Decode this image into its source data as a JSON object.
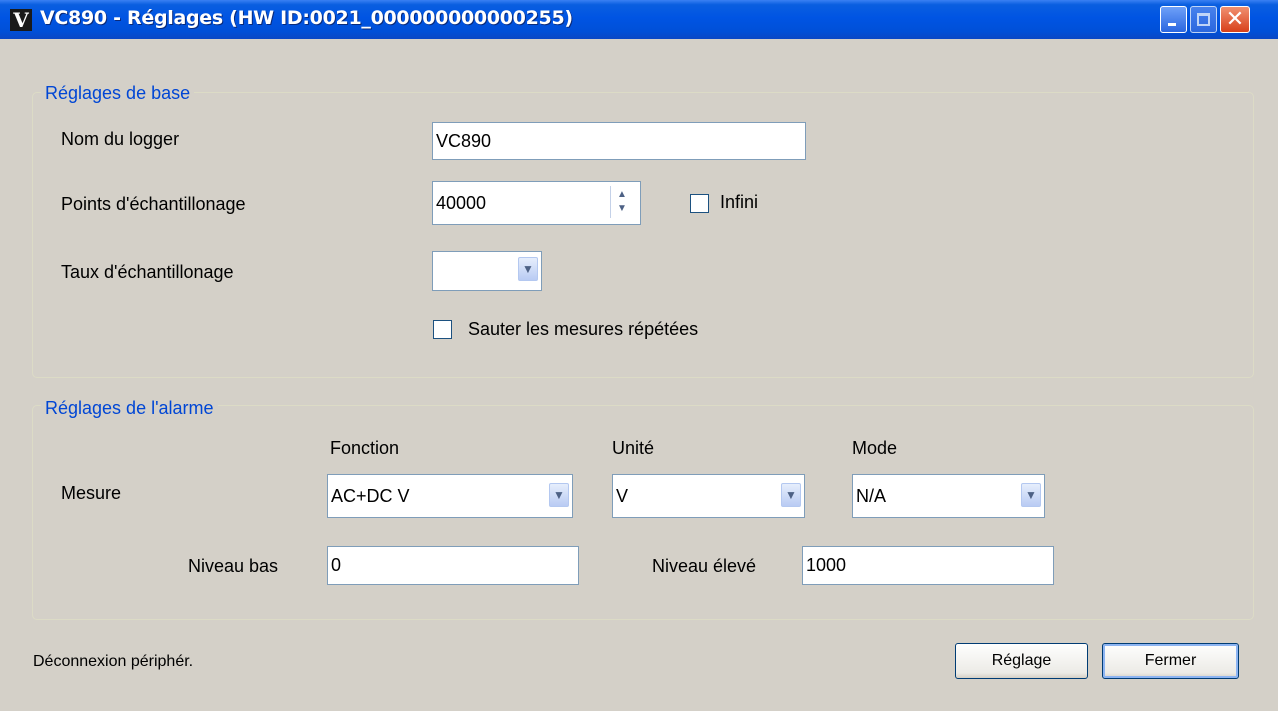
{
  "window": {
    "title": "VC890 - Réglages (HW ID:0021_000000000000255)",
    "app_icon": "V"
  },
  "base_settings": {
    "group_label": "Réglages de base",
    "logger_name_label": "Nom du logger",
    "logger_name_value": "VC890",
    "sample_points_label": "Points d'échantillonage",
    "sample_points_value": "40000",
    "infinite_label": "Infini",
    "infinite_checked": false,
    "sample_rate_label": "Taux d'échantillonage",
    "sample_rate_value": "",
    "skip_repeated_label": "Sauter les mesures répétées",
    "skip_repeated_checked": false
  },
  "alarm_settings": {
    "group_label": "Réglages de l'alarme",
    "function_header": "Fonction",
    "unit_header": "Unité",
    "mode_header": "Mode",
    "measure_label": "Mesure",
    "function_value": "AC+DC V",
    "unit_value": "V",
    "mode_value": "N/A",
    "low_level_label": "Niveau bas",
    "low_level_value": "0",
    "high_level_label": "Niveau élevé",
    "high_level_value": "1000"
  },
  "status_text": "Déconnexion périphér.",
  "buttons": {
    "apply_label": "Réglage",
    "close_label": "Fermer"
  },
  "icons": {
    "minimize": "minimize-icon",
    "maximize": "maximize-icon",
    "close": "close-icon",
    "dropdown": "chevron-down-icon",
    "spin_up": "arrow-up-icon",
    "spin_down": "arrow-down-icon"
  },
  "colors": {
    "title_bar": "#0054e3",
    "group_label": "#0046d5",
    "window_bg": "#d4d0c8",
    "close_button": "#d8401a"
  }
}
